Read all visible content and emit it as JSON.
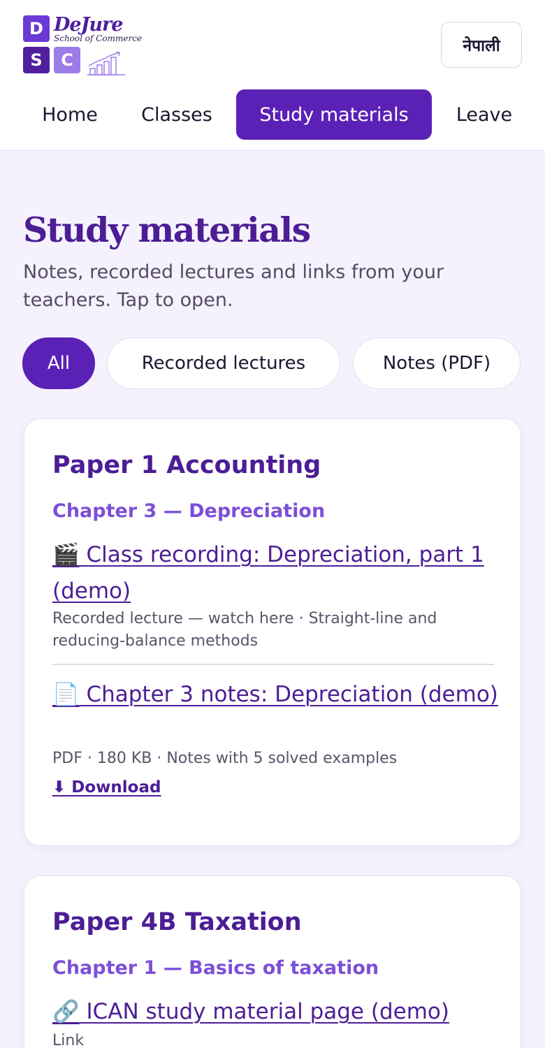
{
  "logo": {
    "letters": [
      "D",
      "S",
      "C"
    ],
    "brand_name": "DeJure",
    "brand_sub": "School of Commerce"
  },
  "language_toggle": "नेपाली",
  "nav": {
    "items": [
      {
        "label": "Home",
        "active": false
      },
      {
        "label": "Classes",
        "active": false
      },
      {
        "label": "Study materials",
        "active": true
      },
      {
        "label": "Leave",
        "active": false
      }
    ]
  },
  "page": {
    "title": "Study materials",
    "description": "Notes, recorded lectures and links from your teachers. Tap to open."
  },
  "filters": [
    {
      "label": "All",
      "active": true
    },
    {
      "label": "Recorded lectures",
      "active": false
    },
    {
      "label": "Notes (PDF)",
      "active": false
    }
  ],
  "subjects": [
    {
      "title": "Paper 1 Accounting",
      "chapter": "Chapter 3 — Depreciation",
      "items": [
        {
          "icon": "clapper-board-icon",
          "glyph": "🎬",
          "label": "Class recording: Depreciation, part 1 (demo)",
          "meta": "Recorded lecture — watch here · Straight-line and reducing-balance methods"
        },
        {
          "icon": "document-icon",
          "glyph": "📄",
          "label": "Chapter 3 notes: Depreciation (demo)",
          "meta": "PDF · 180 KB · Notes with 5 solved examples",
          "download": "⬇ Download"
        }
      ]
    },
    {
      "title": "Paper 4B Taxation",
      "chapter": "Chapter 1 — Basics of taxation",
      "items": [
        {
          "icon": "link-icon",
          "glyph": "🔗",
          "label": "ICAN study material page (demo)",
          "meta": "Link"
        }
      ]
    }
  ],
  "colors": {
    "primary": "#5b21b6",
    "heading": "#4c1d95",
    "chapter": "#7c4fd8",
    "background": "#f5f2fd"
  }
}
